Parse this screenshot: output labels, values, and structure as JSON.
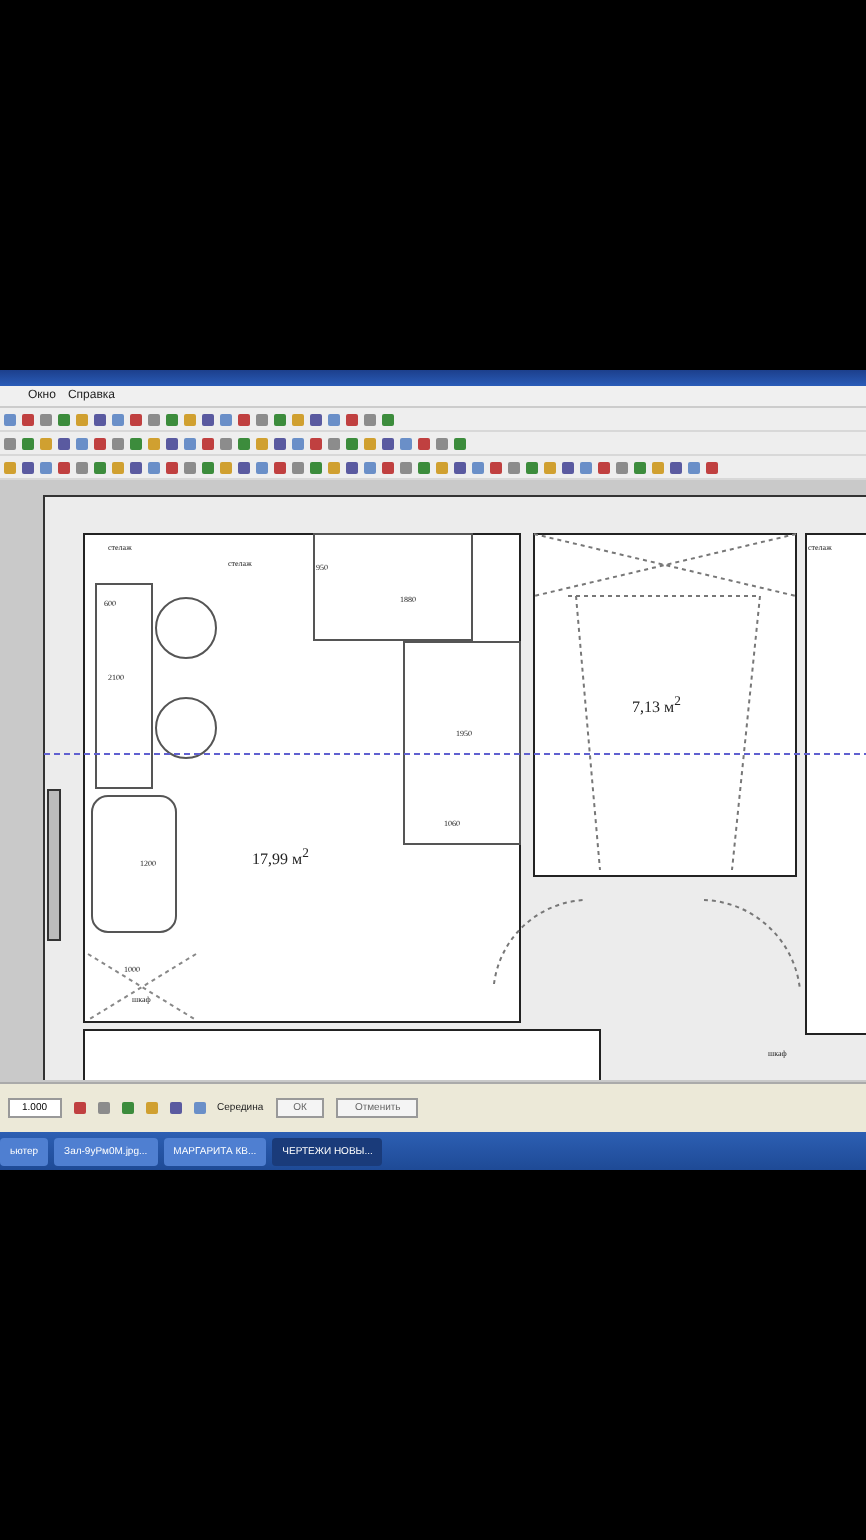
{
  "menu": [
    "Окно",
    "Справка"
  ],
  "plan": {
    "rooms": [
      {
        "area": "17,99 м$^{2}$"
      },
      {
        "area": "7,13 м$^{2}$"
      }
    ],
    "labels": [
      "стелаж",
      "стелаж",
      "600",
      "2100",
      "1880",
      "950",
      "1950",
      "1060",
      "1200",
      "1000",
      "шкаф",
      "стелаж",
      "шкаф"
    ]
  },
  "info_box": {
    "field_value": "1.000",
    "snap_label": "Середина",
    "ok": "ОК",
    "cancel": "Отменить"
  },
  "taskbar": [
    {
      "label": "ьютер",
      "selected": false
    },
    {
      "label": "Зал-9уРм0M.jpg...",
      "selected": false
    },
    {
      "label": "МАРГАРИТА КВ...",
      "selected": false
    },
    {
      "label": "ЧЕРТЕЖИ НОВЫ...",
      "selected": true
    }
  ]
}
